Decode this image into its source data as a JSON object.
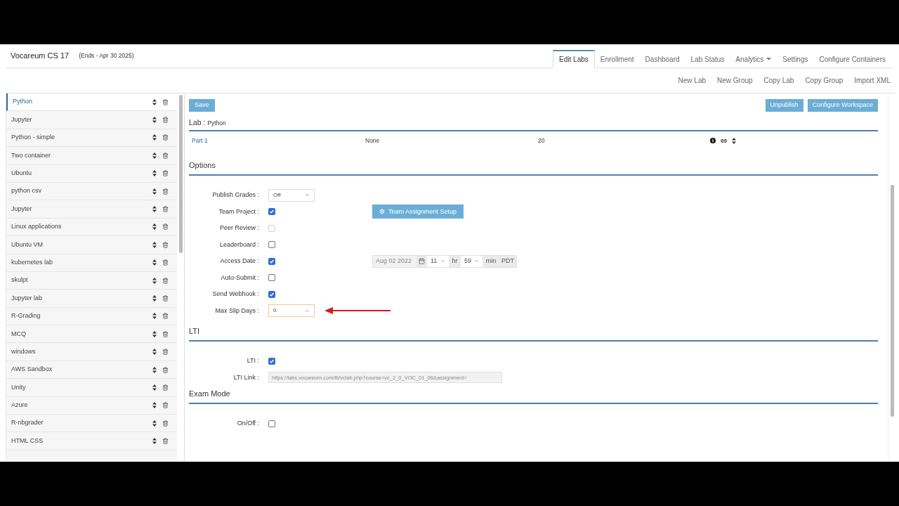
{
  "header": {
    "title": "Vocareum CS 17",
    "subtitle": "(Ends - Apr 30 2025)"
  },
  "nav_tabs": [
    {
      "label": "Edit Labs",
      "selected": true,
      "dropdown": false
    },
    {
      "label": "Enrollment",
      "selected": false,
      "dropdown": false
    },
    {
      "label": "Dashboard",
      "selected": false,
      "dropdown": false
    },
    {
      "label": "Lab Status",
      "selected": false,
      "dropdown": false
    },
    {
      "label": "Analytics",
      "selected": false,
      "dropdown": true
    },
    {
      "label": "Settings",
      "selected": false,
      "dropdown": false
    },
    {
      "label": "Configure Containers",
      "selected": false,
      "dropdown": false
    }
  ],
  "actions": [
    "New Lab",
    "New Group",
    "Copy Lab",
    "Copy Group",
    "Import XML"
  ],
  "sidebar": {
    "items": [
      {
        "label": "Python",
        "selected": true
      },
      {
        "label": "Jupyter",
        "selected": false
      },
      {
        "label": "Python - simple",
        "selected": false
      },
      {
        "label": "Two container",
        "selected": false
      },
      {
        "label": "Ubuntu",
        "selected": false
      },
      {
        "label": "python csv",
        "selected": false
      },
      {
        "label": "Jupyter",
        "selected": false
      },
      {
        "label": "Linux applications",
        "selected": false
      },
      {
        "label": "Ubuntu VM",
        "selected": false
      },
      {
        "label": "kubernetes lab",
        "selected": false
      },
      {
        "label": "skulpt",
        "selected": false
      },
      {
        "label": "Jupyter lab",
        "selected": false
      },
      {
        "label": "R-Grading",
        "selected": false
      },
      {
        "label": "MCQ",
        "selected": false
      },
      {
        "label": "windows",
        "selected": false
      },
      {
        "label": "AWS Sandbox",
        "selected": false
      },
      {
        "label": "Unity",
        "selected": false
      },
      {
        "label": "Azure",
        "selected": false
      },
      {
        "label": "R-nbgrader",
        "selected": false
      },
      {
        "label": "HTML CSS",
        "selected": false
      }
    ]
  },
  "lab": {
    "save": "Save",
    "buttons": [
      "Unpublish",
      "Configure Workspace"
    ],
    "label": "Lab :",
    "name": "Python",
    "parts": [
      {
        "name": "Part 1",
        "column_2": "None",
        "column_3": "20"
      }
    ]
  },
  "sections": [
    {
      "title": "Options",
      "rows": [
        {
          "kind": "select",
          "label": "Publish Grades :",
          "value": "Off",
          "focused": false,
          "annotated": false
        },
        {
          "kind": "checkbox",
          "label": "Team Project :",
          "checked": true,
          "disabled": false,
          "button": "Team Assignment Setup"
        },
        {
          "kind": "checkbox",
          "label": "Peer Review :",
          "checked": false,
          "disabled": true
        },
        {
          "kind": "checkbox",
          "label": "Leaderboard :",
          "checked": false,
          "disabled": false
        },
        {
          "kind": "checkbox",
          "label": "Access Date :",
          "checked": true,
          "disabled": false,
          "date": {
            "date": "Aug 02 2022",
            "hour": "11",
            "hour_unit": "hr",
            "minute": "59",
            "minute_unit": "min",
            "zone": "PDT"
          }
        },
        {
          "kind": "checkbox",
          "label": "Auto-Submit :",
          "checked": false,
          "disabled": false
        },
        {
          "kind": "checkbox",
          "label": "Send Webhook :",
          "checked": true,
          "disabled": false
        },
        {
          "kind": "select",
          "label": "Max Slip Days :",
          "value": "0",
          "focused": true,
          "annotated": true
        }
      ]
    },
    {
      "title": "LTI",
      "rows": [
        {
          "kind": "checkbox",
          "label": "LTI :",
          "checked": true,
          "disabled": false
        },
        {
          "kind": "text",
          "label": "LTI Link :",
          "value": "https://labs.vocareum.com/lti/vclab.php?course=vc_2_0_VOC_01_06&assignment="
        }
      ]
    },
    {
      "title": "Exam Mode",
      "rows": [
        {
          "kind": "checkbox",
          "label": "On/Off :",
          "checked": false,
          "disabled": false
        }
      ]
    }
  ]
}
